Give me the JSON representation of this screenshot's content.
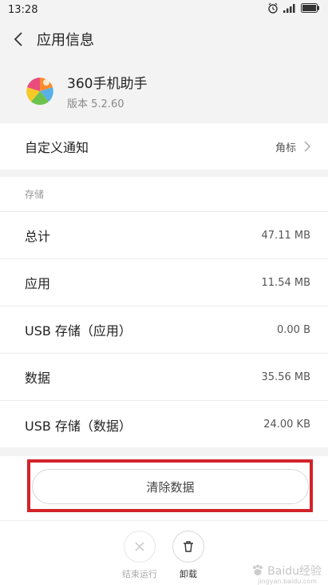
{
  "status": {
    "time": "13:28"
  },
  "header": {
    "title": "应用信息"
  },
  "app": {
    "name": "360手机助手",
    "version": "版本 5.2.60"
  },
  "notification": {
    "label": "自定义通知",
    "value": "角标"
  },
  "storage": {
    "section_title": "存储",
    "rows": [
      {
        "label": "总计",
        "value": "47.11 MB"
      },
      {
        "label": "应用",
        "value": "11.54 MB"
      },
      {
        "label": "USB 存储（应用）",
        "value": "0.00 B"
      },
      {
        "label": "数据",
        "value": "35.56 MB"
      },
      {
        "label": "USB 存储（数据）",
        "value": "24.00 KB"
      }
    ]
  },
  "actions": {
    "clear_data": "清除数据"
  },
  "bottom": {
    "stop": "结束运行",
    "uninstall": "卸载"
  },
  "watermark": {
    "text": "Baidu经验",
    "sub": "jingyan.baidu.com"
  },
  "colors": {
    "highlight": "#d2232a",
    "background": "#f3f3f3"
  }
}
